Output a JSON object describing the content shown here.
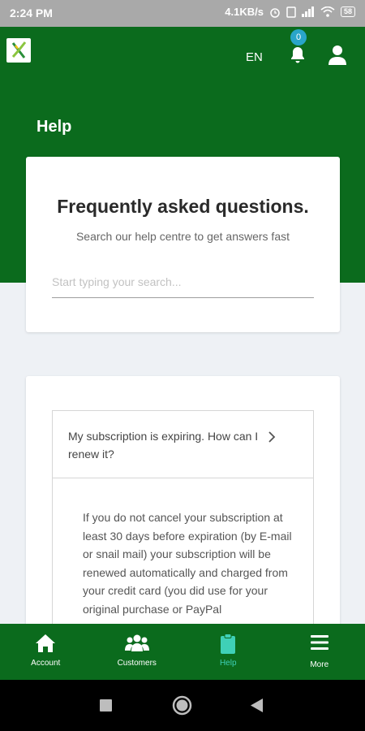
{
  "status_bar": {
    "time": "2:24 PM",
    "net_speed": "4.1KB/s",
    "battery": "58"
  },
  "app_bar": {
    "logo_icon": "brand-logo-icon",
    "language": "EN",
    "notification_count": "0",
    "notification_icon": "bell-icon",
    "profile_icon": "user-icon"
  },
  "page": {
    "title": "Help"
  },
  "faq": {
    "title": "Frequently asked questions.",
    "subtitle": "Search our help centre to get answers fast",
    "search_placeholder": "Start typing your search..."
  },
  "accordion": {
    "question": "My subscription is expiring. How can I renew it?",
    "answer": "If you do not cancel your subscription at least 30 days before expiration (by E-mail or snail mail) your subscription will be renewed automatically and charged from your credit card (you did use for your original purchase or PayPal"
  },
  "bottom_nav": {
    "items": [
      {
        "label": "Account",
        "icon": "home-icon"
      },
      {
        "label": "Customers",
        "icon": "users-icon"
      },
      {
        "label": "Help",
        "icon": "clipboard-icon"
      },
      {
        "label": "More",
        "icon": "menu-icon"
      }
    ],
    "active": "Help"
  },
  "colors": {
    "brand_green": "#0b6b1d",
    "active_tab": "#3fd0b7",
    "badge": "#29a5c9"
  }
}
